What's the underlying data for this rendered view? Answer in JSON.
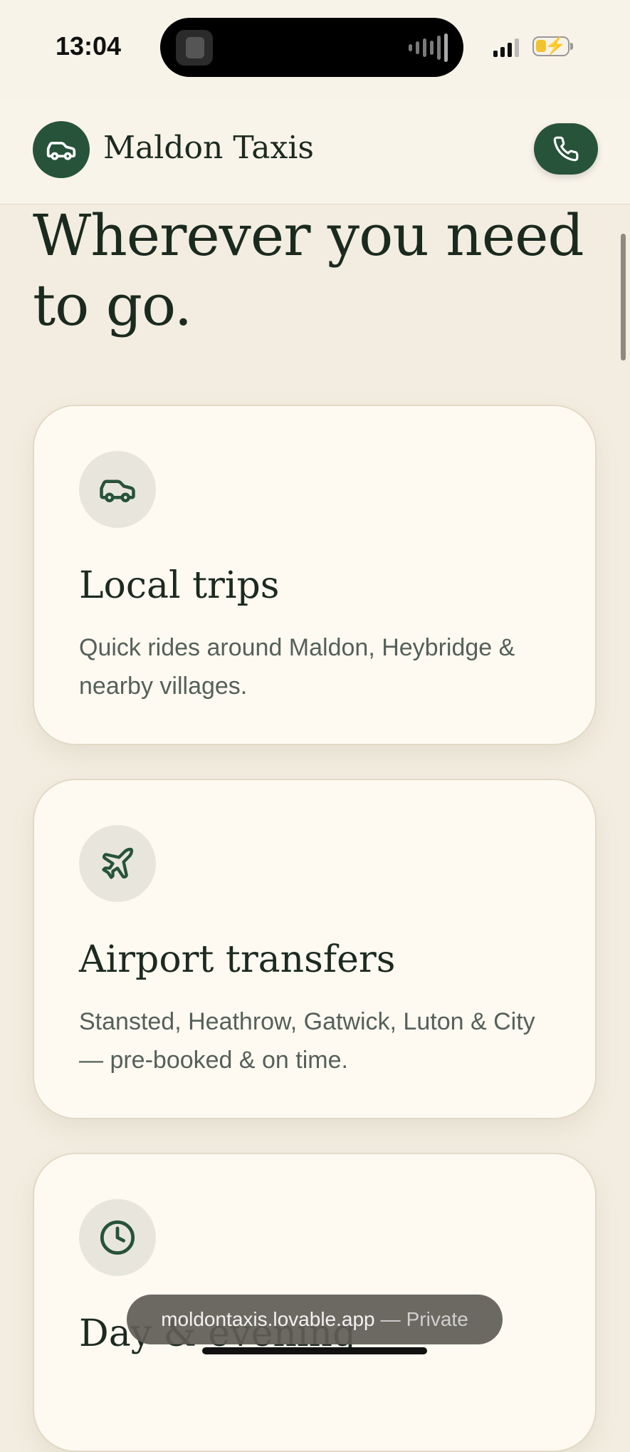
{
  "status_bar": {
    "time": "13:04"
  },
  "header": {
    "brand": "Maldon Taxis",
    "logo_icon": "car-icon",
    "call_icon": "phone-icon"
  },
  "hero": {
    "headline": "Wherever you need to go."
  },
  "services": [
    {
      "icon": "car-icon",
      "title": "Local trips",
      "description": "Quick rides around Maldon, Heybridge & nearby villages."
    },
    {
      "icon": "plane-icon",
      "title": "Airport transfers",
      "description": "Stansted, Heathrow, Gatwick, Luton & City — pre-booked & on time."
    },
    {
      "icon": "clock-icon",
      "title": "Day & evening",
      "description": ""
    }
  ],
  "browser": {
    "url": "moldontaxis.lovable.app",
    "separator": "—",
    "mode": "Private"
  },
  "colors": {
    "brand_green": "#27533a",
    "background": "#f3ede1",
    "card": "#fefaf2",
    "icon_circle": "#e8e6dc"
  }
}
